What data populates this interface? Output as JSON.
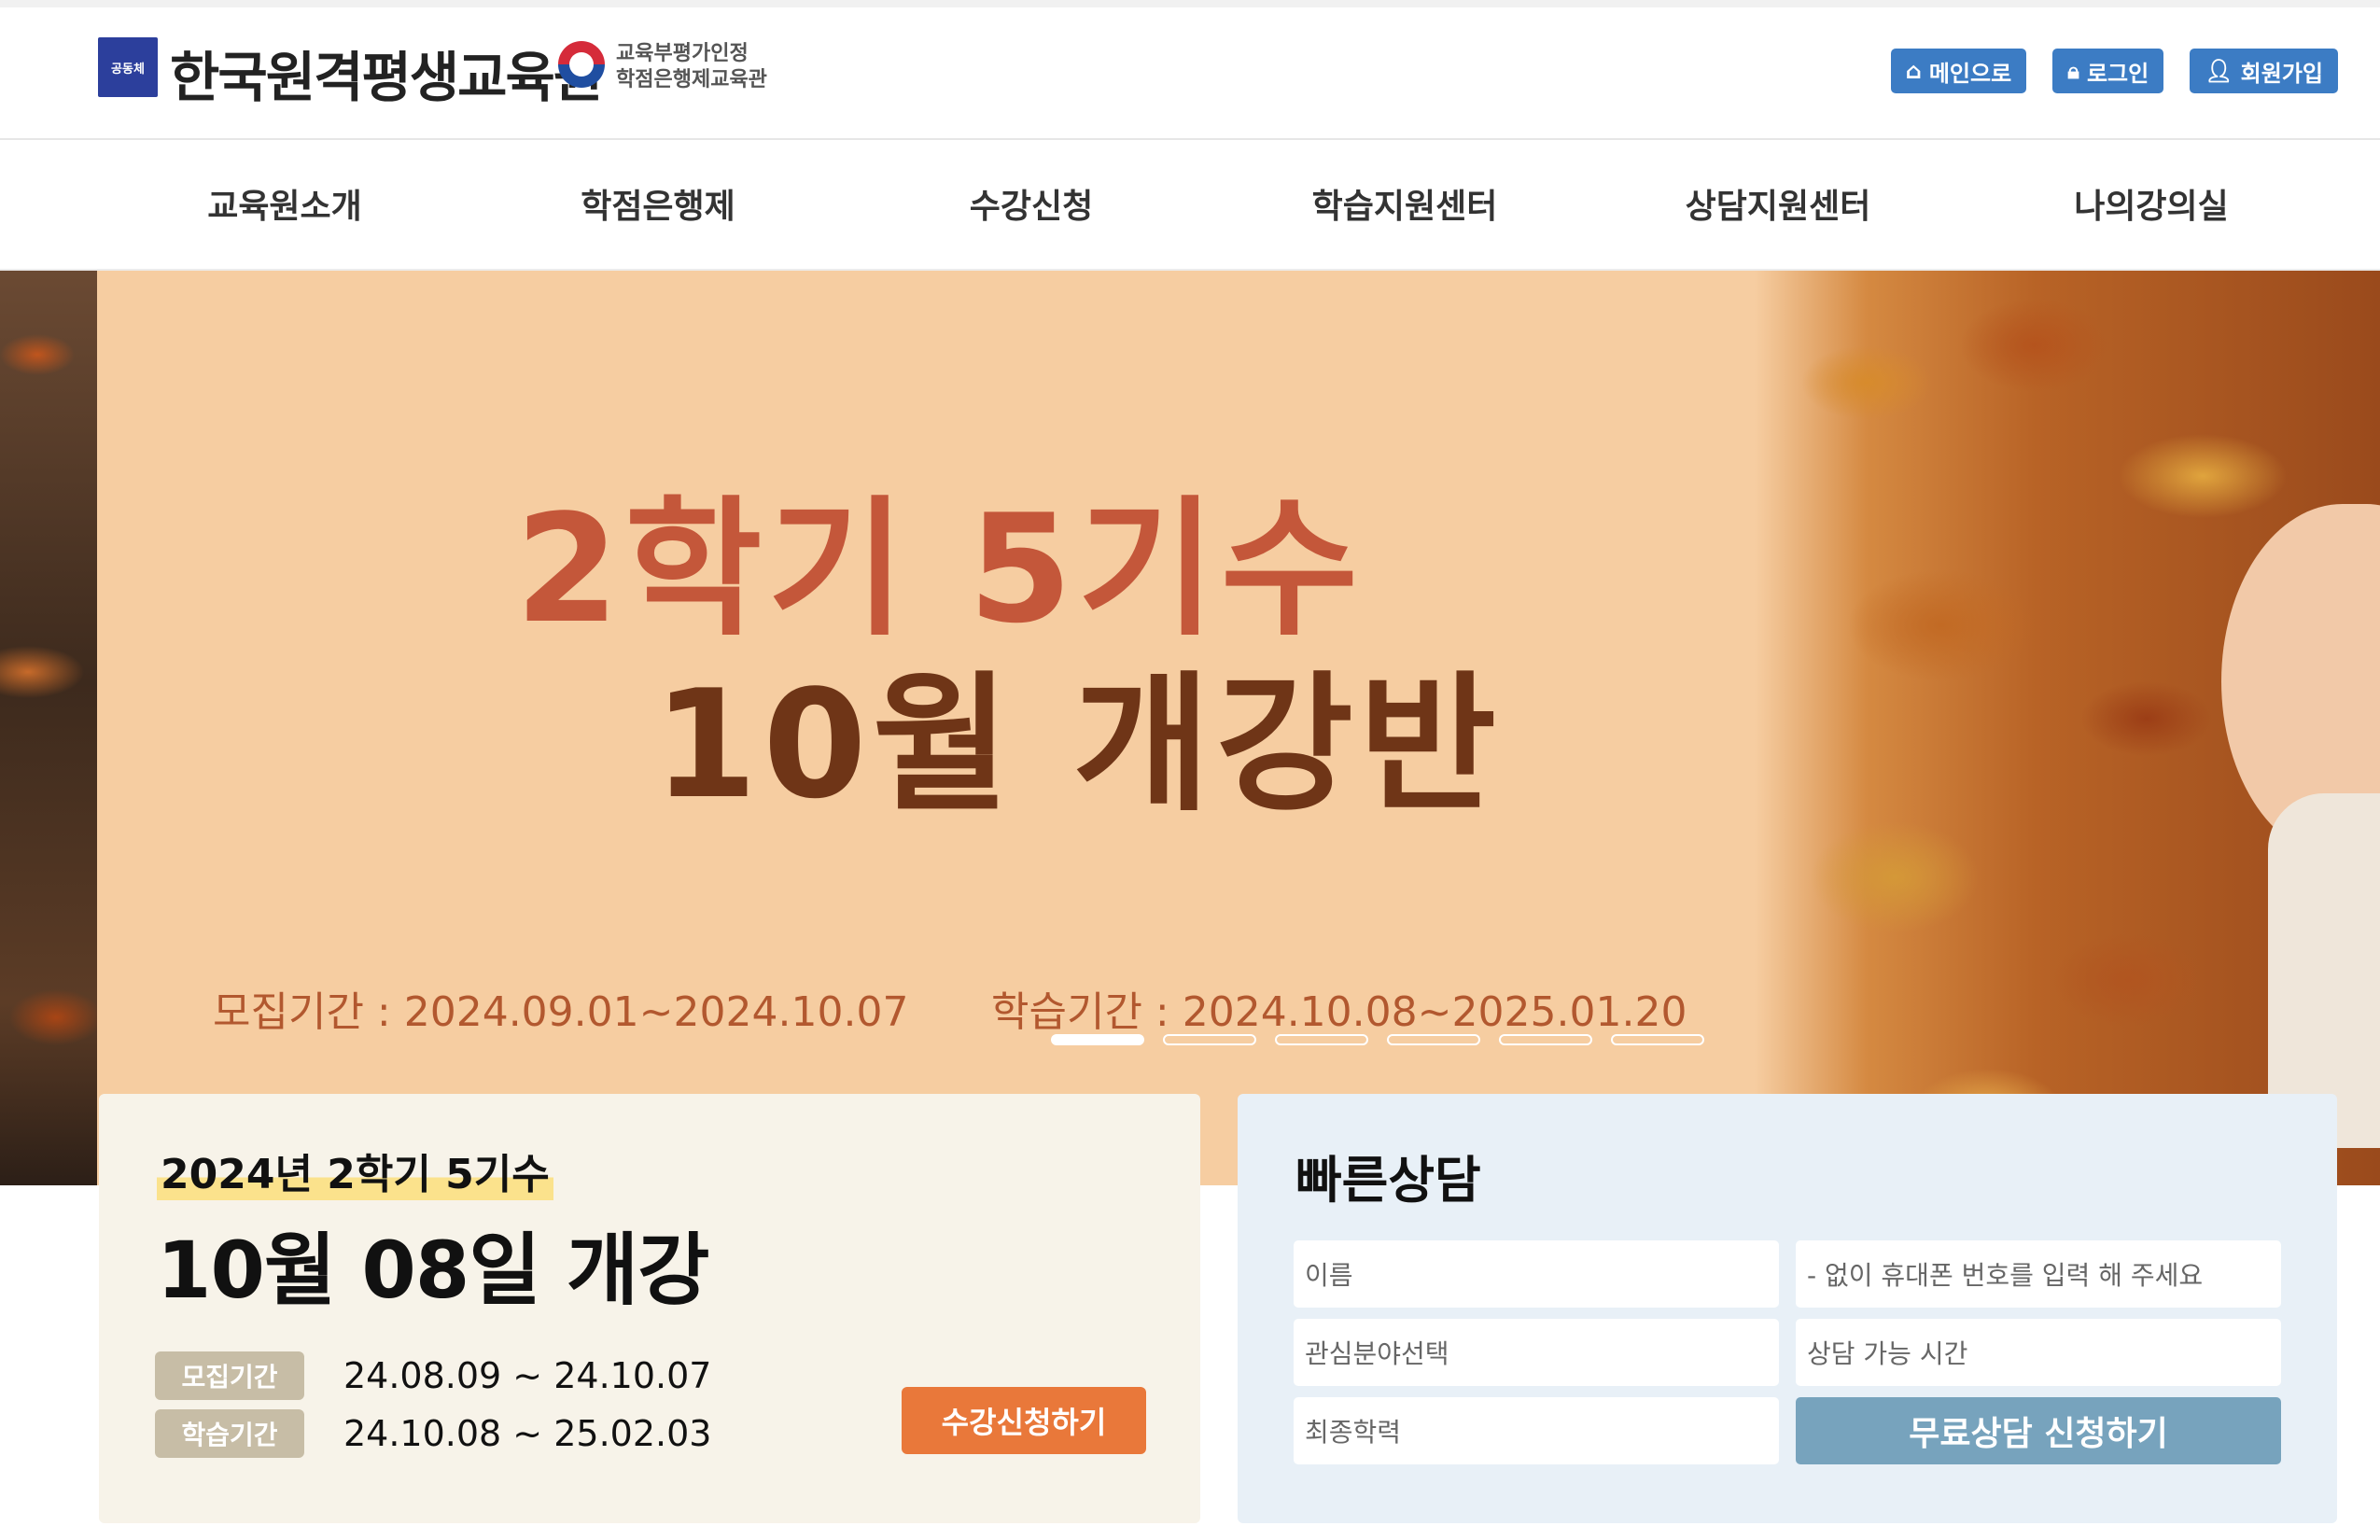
{
  "header": {
    "logo_mark": "공동체",
    "org_name": "한국원격평생교육원",
    "org_sub_line1": "교육부평가인정",
    "org_sub_line2": "학점은행제교육관",
    "buttons": [
      {
        "label": "메인으로",
        "icon": "home-icon"
      },
      {
        "label": "로그인",
        "icon": "lock-icon"
      },
      {
        "label": "회원가입",
        "icon": "user-icon"
      }
    ]
  },
  "nav": {
    "items": [
      "교육원소개",
      "학점은행제",
      "수강신청",
      "학습지원센터",
      "상담지원센터",
      "나의강의실"
    ]
  },
  "banner": {
    "headline_line1": "2학기 5기수",
    "headline_line2": "10월 개강반",
    "recruit_period": "모집기간 : 2024.09.01~2024.10.07",
    "study_period": "학습기간 : 2024.10.08~2025.01.20",
    "slide_count": 6,
    "active_slide": 1
  },
  "course_card": {
    "subtitle": "2024년 2학기 5기수",
    "title": "10월 08일 개강",
    "recruit_tag": "모집기간",
    "recruit_value": "24.08.09 ~ 24.10.07",
    "study_tag": "학습기간",
    "study_value": "24.10.08 ~ 25.02.03",
    "apply_button": "수강신청하기"
  },
  "quick_consult": {
    "title": "빠른상담",
    "name_placeholder": "이름",
    "phone_placeholder": "- 없이 휴대폰 번호를 입력 해 주세요",
    "interest_select": "관심분야선택",
    "time_select": "상담 가능 시간",
    "education_select": "최종학력",
    "submit_button": "무료상담 신청하기"
  },
  "colors": {
    "brand_blue": "#3c7cc4",
    "banner_bg": "#f6cda1",
    "headline_red": "#c4573a",
    "headline_brown": "#6f3517",
    "apply_orange": "#e9783a",
    "consult_submit": "#77a3bd"
  }
}
